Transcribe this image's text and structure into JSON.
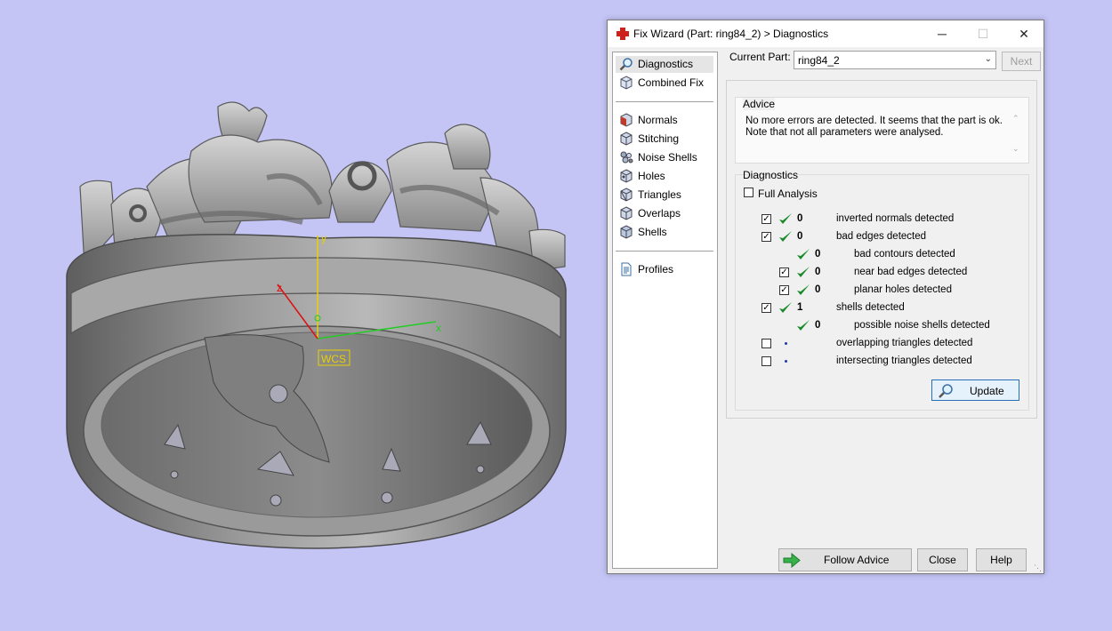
{
  "window": {
    "title": "Fix Wizard (Part: ring84_2) > Diagnostics",
    "minimize": "─",
    "maximize": "☐",
    "close": "✕"
  },
  "viewport": {
    "axis_y": "y",
    "axis_x": "x",
    "axis_z": "z",
    "wcs_label": "WCS"
  },
  "nav": {
    "items": [
      {
        "label": "Diagnostics",
        "icon": "magnifier-icon"
      },
      {
        "label": "Combined Fix",
        "icon": "cube-icon"
      },
      {
        "label": "Normals",
        "icon": "normals-cube-icon"
      },
      {
        "label": "Stitching",
        "icon": "stitching-cube-icon"
      },
      {
        "label": "Noise Shells",
        "icon": "noise-shells-icon"
      },
      {
        "label": "Holes",
        "icon": "holes-cube-icon"
      },
      {
        "label": "Triangles",
        "icon": "triangles-cube-icon"
      },
      {
        "label": "Overlaps",
        "icon": "overlaps-cube-icon"
      },
      {
        "label": "Shells",
        "icon": "shells-cube-icon"
      },
      {
        "label": "Profiles",
        "icon": "document-icon"
      }
    ],
    "selected": "Diagnostics"
  },
  "current_part": {
    "label": "Current Part:",
    "value": "ring84_2",
    "next_label": "Next"
  },
  "advice": {
    "legend": "Advice",
    "line1": "No more errors are detected. It seems that the part is ok.",
    "line2": "Note that not all parameters were analysed."
  },
  "diagnostics": {
    "legend": "Diagnostics",
    "full_analysis_label": "Full Analysis",
    "rows": [
      {
        "checked": true,
        "status": "ok",
        "count": "0",
        "label": "inverted normals detected"
      },
      {
        "checked": true,
        "status": "ok",
        "count": "0",
        "label": "bad edges detected"
      },
      {
        "checked": null,
        "status": "ok",
        "count": "0",
        "label": "bad contours detected"
      },
      {
        "checked": true,
        "status": "ok",
        "count": "0",
        "label": "near bad edges detected"
      },
      {
        "checked": true,
        "status": "ok",
        "count": "0",
        "label": "planar holes detected"
      },
      {
        "checked": true,
        "status": "ok",
        "count": "1",
        "label": "shells detected"
      },
      {
        "checked": null,
        "status": "ok",
        "count": "0",
        "label": "possible noise shells detected"
      },
      {
        "checked": false,
        "status": "unknown",
        "count": "",
        "label": "overlapping triangles detected"
      },
      {
        "checked": false,
        "status": "unknown",
        "count": "",
        "label": "intersecting triangles detected"
      }
    ],
    "update_label": "Update"
  },
  "buttons": {
    "follow_advice": "Follow Advice",
    "close": "Close",
    "help": "Help"
  },
  "colors": {
    "background": "#c4c4f5",
    "check_green": "#1a8a2a",
    "axis_x": "#22cc22",
    "axis_y": "#e8d000",
    "axis_z": "#dd1111"
  }
}
